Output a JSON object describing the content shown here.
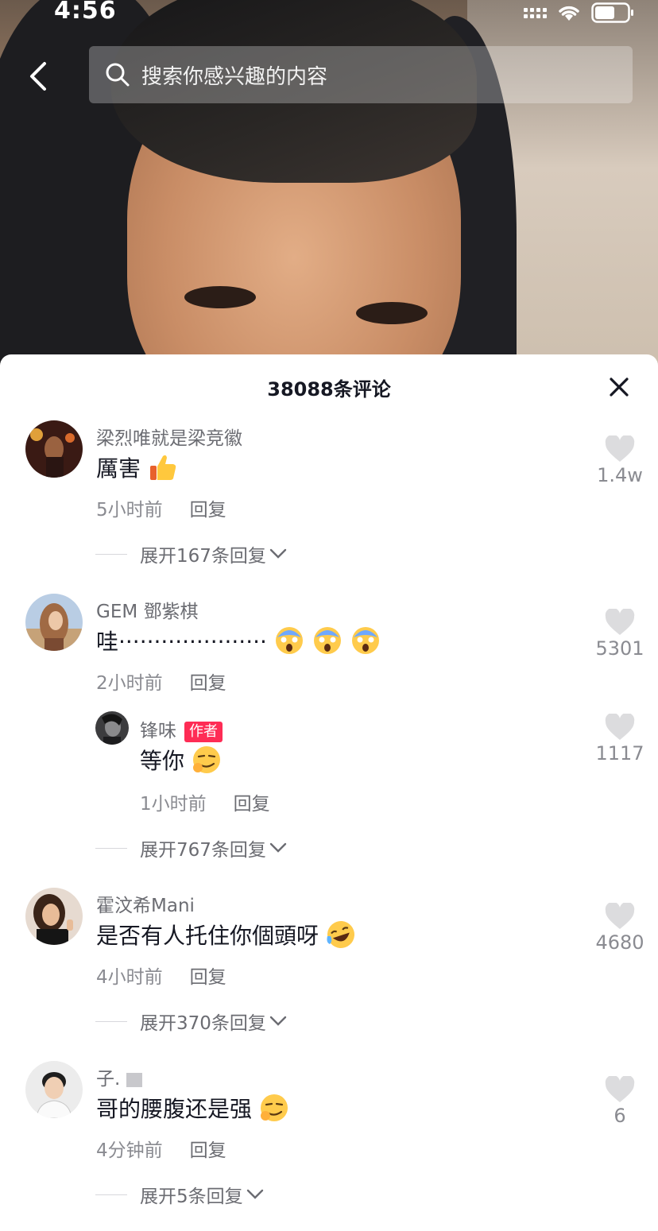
{
  "status": {
    "time": "4:56"
  },
  "search": {
    "placeholder": "搜索你感兴趣的内容"
  },
  "sheet": {
    "title": "38088条评论"
  },
  "comments": [
    {
      "username": "梁烈唯就是梁竞徽",
      "text": "厲害",
      "emoji": "thumbs-up-icon",
      "time": "5小时前",
      "reply": "回复",
      "likes": "1.4w",
      "expand": "展开167条回复"
    },
    {
      "username": "GEM 鄧紫棋",
      "text": "哇·····················",
      "emoji": "screaming-face-icon",
      "time": "2小时前",
      "reply": "回复",
      "likes": "5301",
      "expand": "展开767条回复",
      "author_reply": {
        "username": "锋味",
        "badge": "作者",
        "text": "等你",
        "emoji": "smirking-face-icon",
        "time": "1小时前",
        "reply": "回复",
        "likes": "1117"
      }
    },
    {
      "username": "霍汶希Mani",
      "text": "是否有人托住你個頭呀",
      "emoji": "laughing-tears-icon",
      "time": "4小时前",
      "reply": "回复",
      "likes": "4680",
      "expand": "展开370条回复"
    },
    {
      "username": "子.",
      "text": "哥的腰腹还是强",
      "emoji": "smirking-face-icon",
      "time": "4分钟前",
      "reply": "回复",
      "likes": "6",
      "expand": "展开5条回复"
    }
  ]
}
